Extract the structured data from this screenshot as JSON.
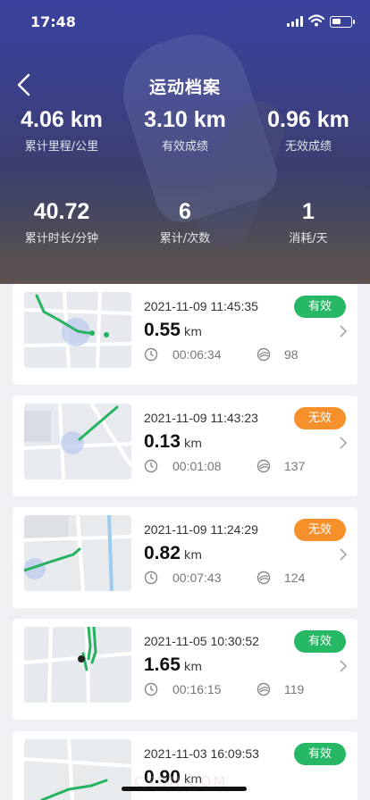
{
  "status_bar": {
    "time": "17:48"
  },
  "nav": {
    "title": "运动档案"
  },
  "stats": [
    {
      "value": "4.06 km",
      "label": "累计里程/公里"
    },
    {
      "value": "3.10 km",
      "label": "有效成绩"
    },
    {
      "value": "0.96 km",
      "label": "无效成绩"
    },
    {
      "value": "40.72",
      "label": "累计时长/分钟"
    },
    {
      "value": "6",
      "label": "累计/次数"
    },
    {
      "value": "1",
      "label": "消耗/天"
    }
  ],
  "colors": {
    "valid": "#26b865",
    "invalid": "#f5902a",
    "route": "#25b35f"
  },
  "records": [
    {
      "datetime": "2021-11-09 11:45:35",
      "status": "有效",
      "valid": true,
      "distance": "0.55",
      "unit": "km",
      "duration": "00:06:34",
      "count": "98"
    },
    {
      "datetime": "2021-11-09 11:43:23",
      "status": "无效",
      "valid": false,
      "distance": "0.13",
      "unit": "km",
      "duration": "00:01:08",
      "count": "137"
    },
    {
      "datetime": "2021-11-09 11:24:29",
      "status": "无效",
      "valid": false,
      "distance": "0.82",
      "unit": "km",
      "duration": "00:07:43",
      "count": "124"
    },
    {
      "datetime": "2021-11-05 10:30:52",
      "status": "有效",
      "valid": true,
      "distance": "1.65",
      "unit": "km",
      "duration": "00:16:15",
      "count": "119"
    },
    {
      "datetime": "2021-11-03 16:09:53",
      "status": "有效",
      "valid": true,
      "distance": "0.90",
      "unit": "km",
      "duration": "",
      "count": ""
    }
  ],
  "watermark": "CSDN.COM"
}
